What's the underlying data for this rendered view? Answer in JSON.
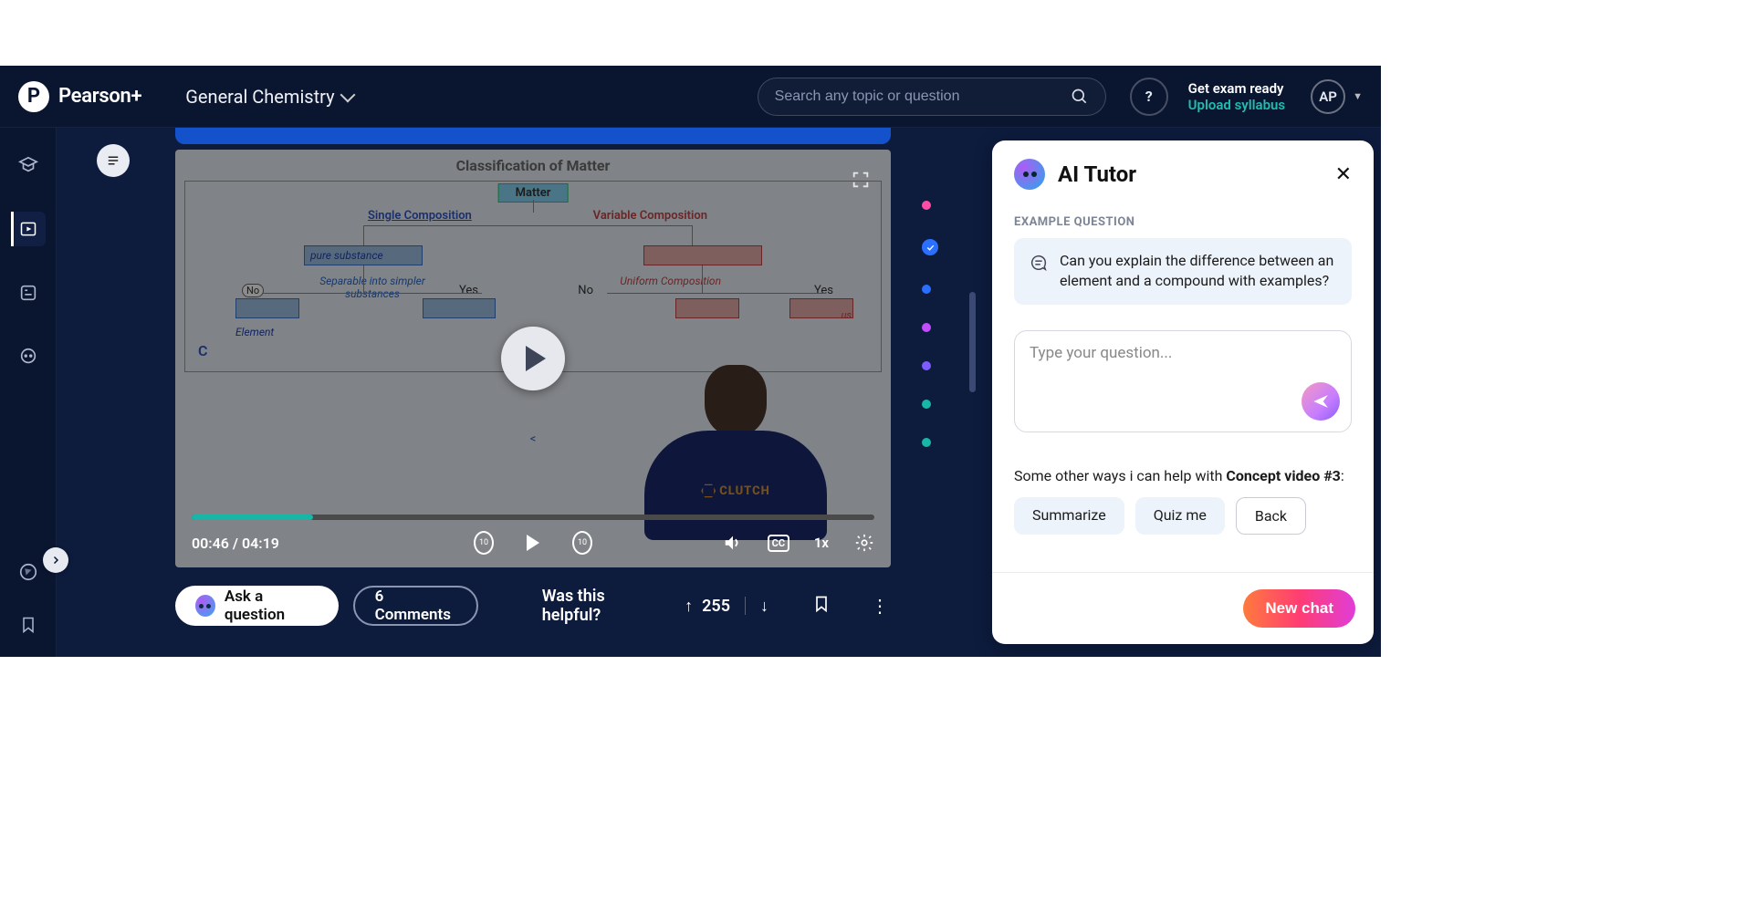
{
  "header": {
    "brand": "Pearson+",
    "course": "General Chemistry",
    "search_placeholder": "Search any topic or question",
    "help_label": "?",
    "exam_line1": "Get exam ready",
    "exam_line2": "Upload syllabus",
    "avatar_initials": "AP"
  },
  "video": {
    "slide_title": "Classification of Matter",
    "matter_label": "Matter",
    "single_comp": "Single Composition",
    "variable_comp": "Variable Composition",
    "pure_substance": "pure  substance",
    "separable": "Separable into simpler substances",
    "uniform": "Uniform Composition",
    "yes": "Yes",
    "no": "No",
    "element": "Element",
    "us": "us",
    "c_letter": "C",
    "arrow_center": "<",
    "instructor_logo": "CLUTCH",
    "time_current": "00:46",
    "time_total": "04:19",
    "speed": "1x",
    "cc": "CC",
    "skip_back": "10",
    "skip_fwd": "10"
  },
  "under": {
    "ask": "Ask a question",
    "comments": "6 Comments",
    "helpful": "Was this helpful?",
    "votes": "255"
  },
  "dots": {
    "colors": [
      "#ff4da6",
      "#2a6fff",
      "#2a6fff",
      "#c24dff",
      "#7d5cff",
      "#17b6a7",
      "#17b6a7"
    ]
  },
  "tutor": {
    "title": "AI Tutor",
    "section": "EXAMPLE QUESTION",
    "example": "Can you explain the difference between an element and a compound with examples?",
    "input_placeholder": "Type your question...",
    "help_prefix": "Some other ways i can help with ",
    "help_bold": "Concept video #3",
    "chips": {
      "summarize": "Summarize",
      "quiz": "Quiz me",
      "back": "Back"
    },
    "new_chat": "New chat"
  }
}
